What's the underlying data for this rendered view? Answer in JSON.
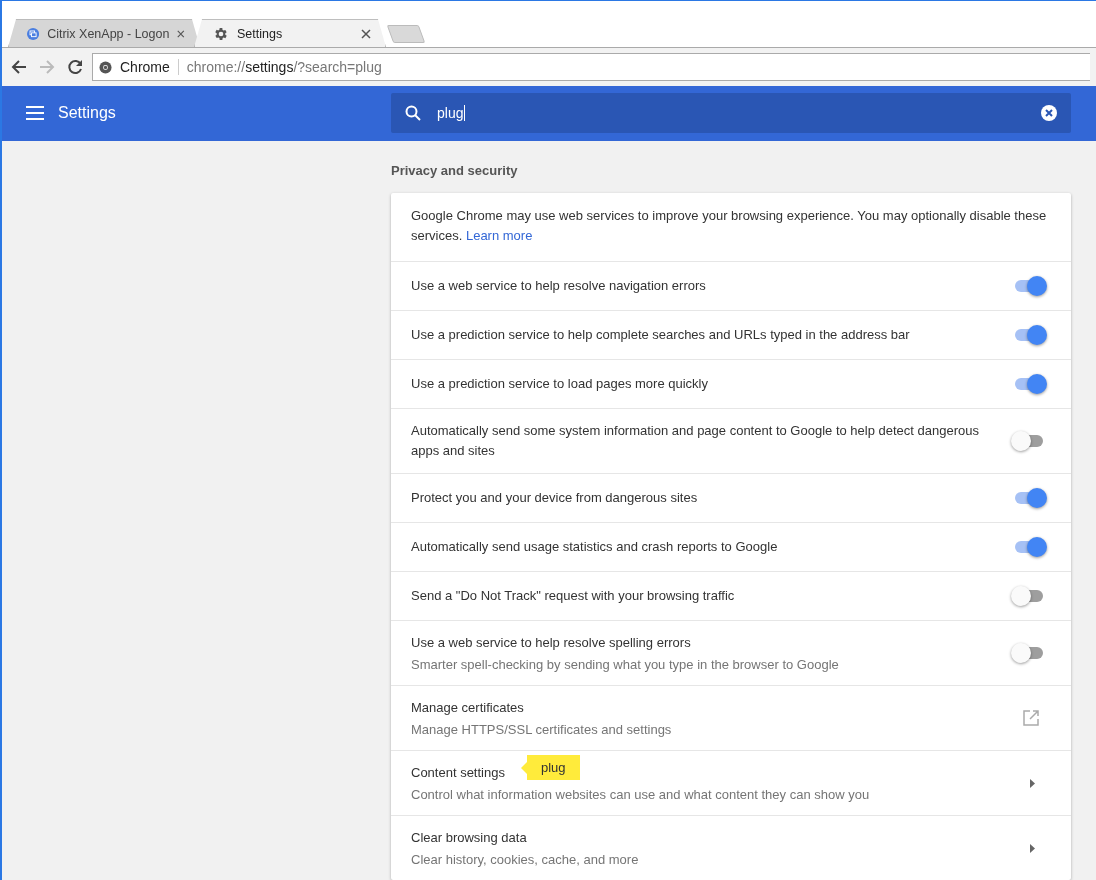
{
  "tabs": [
    {
      "title": "Citrix XenApp - Logon",
      "selected": false
    },
    {
      "title": "Settings",
      "selected": true
    }
  ],
  "omnibox": {
    "site_label": "Chrome",
    "url": {
      "scheme": "chrome://",
      "host": "settings",
      "path": "/?search=plug"
    }
  },
  "header": {
    "title": "Settings",
    "search_value": "plug"
  },
  "section": {
    "title": "Privacy and security",
    "intro": {
      "text": "Google Chrome may use web services to improve your browsing experience. You may optionally disable these services.",
      "link": "Learn more"
    },
    "rows": [
      {
        "kind": "toggle",
        "label": "Use a web service to help resolve navigation errors",
        "on": true
      },
      {
        "kind": "toggle",
        "label": "Use a prediction service to help complete searches and URLs typed in the address bar",
        "on": true
      },
      {
        "kind": "toggle",
        "label": "Use a prediction service to load pages more quickly",
        "on": true
      },
      {
        "kind": "toggle",
        "label": "Automatically send some system information and page content to Google to help detect dangerous apps and sites",
        "on": false
      },
      {
        "kind": "toggle",
        "label": "Protect you and your device from dangerous sites",
        "on": true
      },
      {
        "kind": "toggle",
        "label": "Automatically send usage statistics and crash reports to Google",
        "on": true
      },
      {
        "kind": "toggle",
        "label": "Send a \"Do Not Track\" request with your browsing traffic",
        "on": false
      },
      {
        "kind": "toggle",
        "label": "Use a web service to help resolve spelling errors",
        "sublabel": "Smarter spell-checking by sending what you type in the browser to Google",
        "on": false
      },
      {
        "kind": "external",
        "label": "Manage certificates",
        "sublabel": "Manage HTTPS/SSL certificates and settings"
      },
      {
        "kind": "submenu",
        "label": "Content settings",
        "sublabel": "Control what information websites can use and what content they can show you",
        "match": "plug"
      },
      {
        "kind": "submenu",
        "label": "Clear browsing data",
        "sublabel": "Clear history, cookies, cache, and more"
      }
    ]
  }
}
